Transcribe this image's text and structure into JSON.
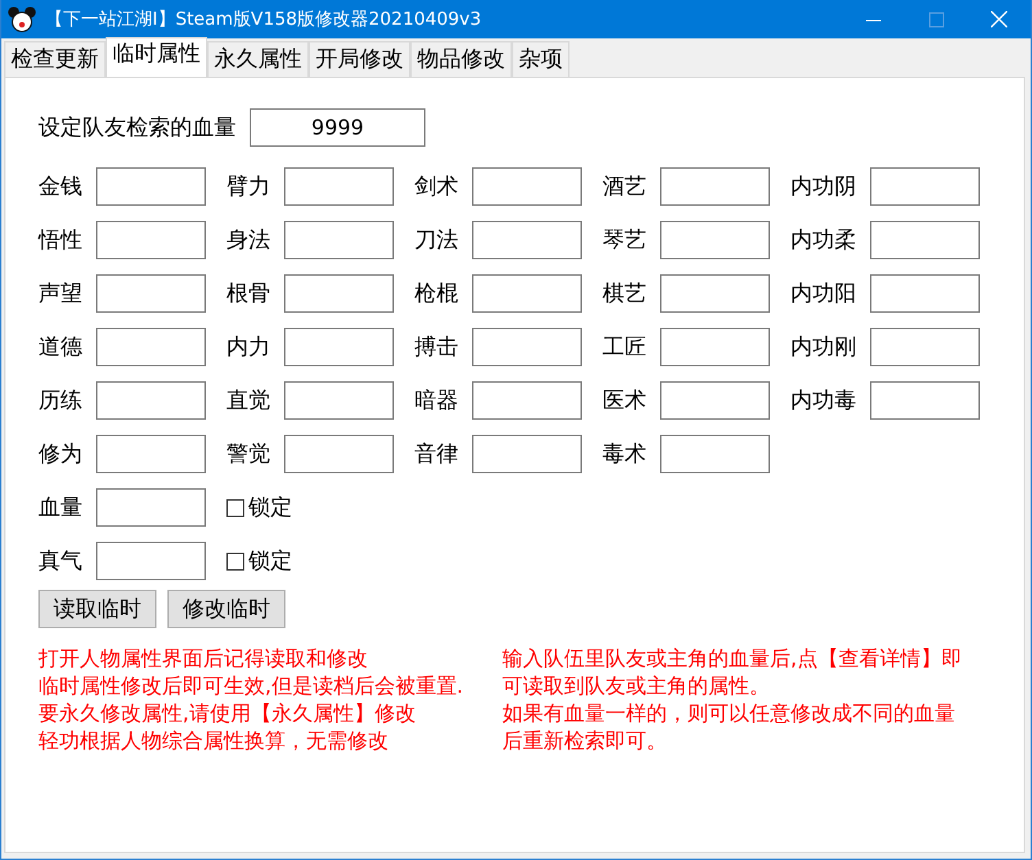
{
  "window": {
    "title": "【下一站江湖I】Steam版V158版修改器20210409v3",
    "maximize_disabled": true
  },
  "tabs": [
    {
      "label": "检查更新",
      "selected": false
    },
    {
      "label": "临时属性",
      "selected": true
    },
    {
      "label": "永久属性",
      "selected": false
    },
    {
      "label": "开局修改",
      "selected": false
    },
    {
      "label": "物品修改",
      "selected": false
    },
    {
      "label": "杂项",
      "selected": false
    }
  ],
  "search": {
    "label": "设定队友检索的血量",
    "value": "9999"
  },
  "attributes": [
    {
      "label": "金钱"
    },
    {
      "label": "臂力"
    },
    {
      "label": "剑术"
    },
    {
      "label": "酒艺"
    },
    {
      "label": "内功阴"
    },
    {
      "label": "悟性"
    },
    {
      "label": "身法"
    },
    {
      "label": "刀法"
    },
    {
      "label": "琴艺"
    },
    {
      "label": "内功柔"
    },
    {
      "label": "声望"
    },
    {
      "label": "根骨"
    },
    {
      "label": "枪棍"
    },
    {
      "label": "棋艺"
    },
    {
      "label": "内功阳"
    },
    {
      "label": "道德"
    },
    {
      "label": "内力"
    },
    {
      "label": "搏击"
    },
    {
      "label": "工匠"
    },
    {
      "label": "内功刚"
    },
    {
      "label": "历练"
    },
    {
      "label": "直觉"
    },
    {
      "label": "暗器"
    },
    {
      "label": "医术"
    },
    {
      "label": "内功毒"
    },
    {
      "label": "修为"
    },
    {
      "label": "警觉"
    },
    {
      "label": "音律"
    },
    {
      "label": "毒术"
    }
  ],
  "locked_stats": [
    {
      "label": "血量",
      "lock_label": "锁定",
      "checked": false
    },
    {
      "label": "真气",
      "lock_label": "锁定",
      "checked": false
    }
  ],
  "buttons": [
    "读取临时",
    "修改临时"
  ],
  "notes_left": [
    "打开人物属性界面后记得读取和修改",
    "临时属性修改后即可生效,但是读档后会被重置.",
    "要永久修改属性,请使用【永久属性】修改",
    "轻功根据人物综合属性换算，无需修改"
  ],
  "notes_right": [
    "输入队伍里队友或主角的血量后,点【查看详情】即",
    "可读取到队友或主角的属性。",
    "如果有血量一样的，则可以任意修改成不同的血量",
    "后重新检索即可。"
  ]
}
